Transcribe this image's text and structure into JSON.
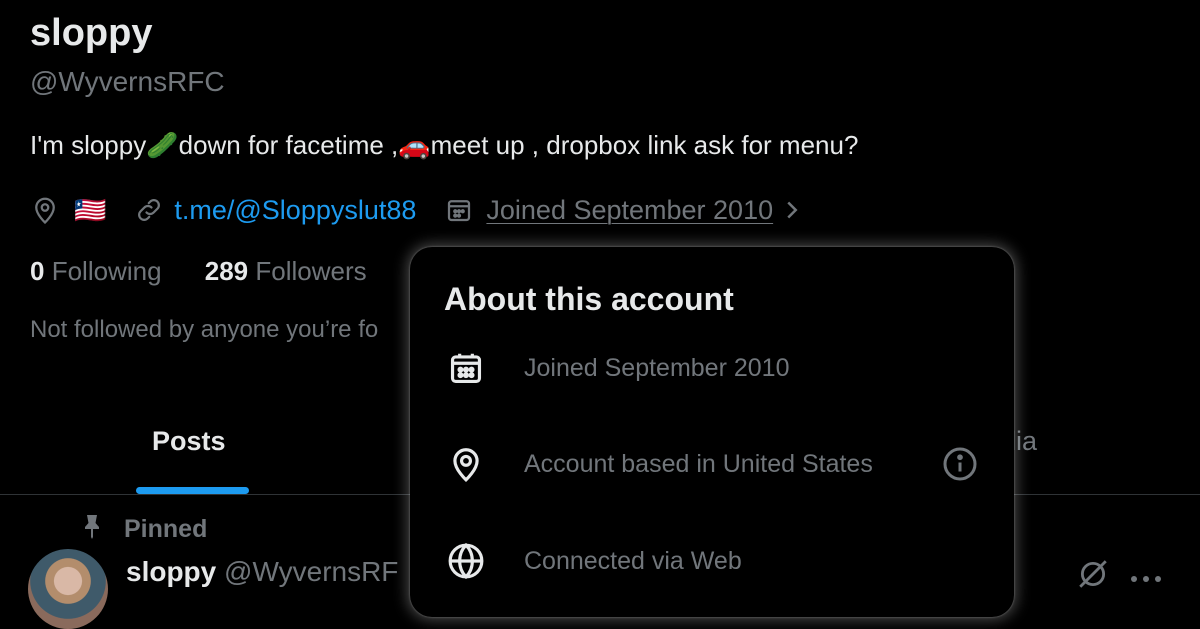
{
  "profile": {
    "name": "sloppy",
    "handle": "@WyvernsRFC",
    "bio_part1": "I'm sloppy",
    "bio_emoji1": "🥒",
    "bio_part2": "down for facetime ,",
    "bio_emoji2": "🚗",
    "bio_part3": "meet up , dropbox link ask for menu?",
    "location_flag": "🇱🇷",
    "link": "t.me/@Sloppyslut88",
    "joined": "Joined September 2010",
    "following_count": "0",
    "following_label": "Following",
    "followers_count": "289",
    "followers_label": "Followers",
    "not_followed": "Not followed by anyone you’re fo"
  },
  "tabs": {
    "posts": "Posts",
    "media_partial": "lia"
  },
  "pinned_post": {
    "pinned_label": "Pinned",
    "author_name": "sloppy",
    "author_handle": "@WyvernsRF"
  },
  "about_popover": {
    "title": "About this account",
    "joined": "Joined September 2010",
    "based_in": "Account based in United States",
    "connected_via": "Connected via Web"
  },
  "colors": {
    "background": "#000000",
    "primary_text": "#e7e9ea",
    "secondary_text": "#71767b",
    "accent": "#1d9bf0"
  },
  "icons": [
    "location-icon",
    "link-icon",
    "calendar-icon",
    "chevron-right-icon",
    "pin-icon",
    "globe-icon",
    "info-icon",
    "grok-icon",
    "more-icon"
  ]
}
